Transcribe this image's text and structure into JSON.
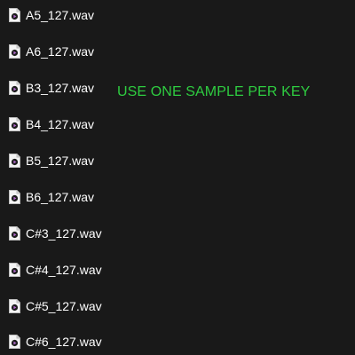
{
  "files": [
    {
      "name": "A5_127.wav",
      "icon": "audio-file-icon"
    },
    {
      "name": "A6_127.wav",
      "icon": "audio-file-icon"
    },
    {
      "name": "B3_127.wav",
      "icon": "audio-file-icon"
    },
    {
      "name": "B4_127.wav",
      "icon": "audio-file-icon"
    },
    {
      "name": "B5_127.wav",
      "icon": "audio-file-icon"
    },
    {
      "name": "B6_127.wav",
      "icon": "audio-file-icon"
    },
    {
      "name": "C#3_127.wav",
      "icon": "audio-file-icon"
    },
    {
      "name": "C#4_127.wav",
      "icon": "audio-file-icon"
    },
    {
      "name": "C#5_127.wav",
      "icon": "audio-file-icon"
    },
    {
      "name": "C#6_127.wav",
      "icon": "audio-file-icon"
    }
  ],
  "annotation": {
    "text": "USE ONE SAMPLE PER KEY",
    "color": "#2ecc40"
  },
  "colors": {
    "background": "#191919",
    "text": "#ffffff",
    "icon_play": "#7a3a8a"
  }
}
